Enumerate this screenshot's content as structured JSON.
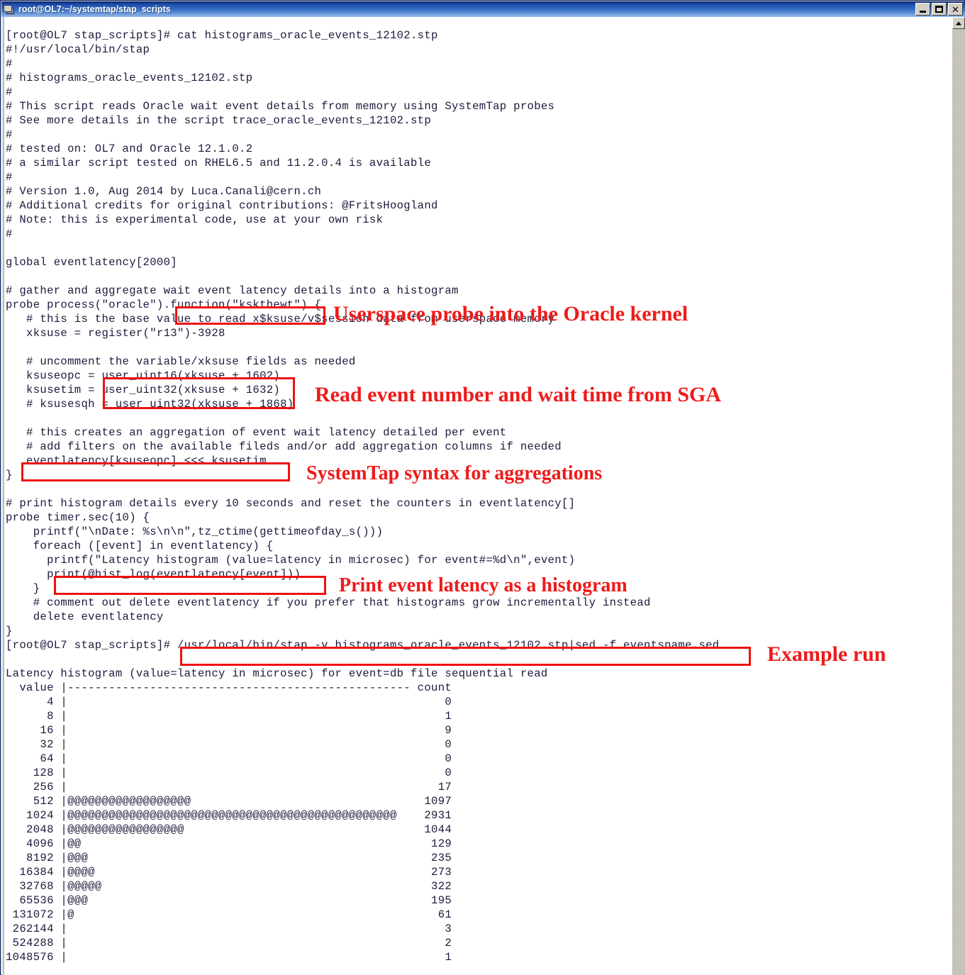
{
  "window": {
    "title": "root@OL7:~/systemtap/stap_scripts",
    "icon": "putty-terminal-icon",
    "buttons": {
      "minimize": "_",
      "maximize": "□",
      "close": "✕"
    }
  },
  "scrollbar": {
    "up_arrow": "scroll-up-arrow"
  },
  "terminal": {
    "text": "[root@OL7 stap_scripts]# cat histograms_oracle_events_12102.stp\n#!/usr/local/bin/stap\n#\n# histograms_oracle_events_12102.stp\n#\n# This script reads Oracle wait event details from memory using SystemTap probes\n# See more details in the script trace_oracle_events_12102.stp\n#\n# tested on: OL7 and Oracle 12.1.0.2\n# a similar script tested on RHEL6.5 and 11.2.0.4 is available\n#\n# Version 1.0, Aug 2014 by Luca.Canali@cern.ch\n# Additional credits for original contributions: @FritsHoogland\n# Note: this is experimental code, use at your own risk\n#\n\nglobal eventlatency[2000]\n\n# gather and aggregate wait event latency details into a histogram\nprobe process(\"oracle\").function(\"kskthewt\") {\n   # this is the base value to read x$ksuse/v$session data from userspace memory\n   xksuse = register(\"r13\")-3928\n\n   # uncomment the variable/xksuse fields as needed\n   ksuseopc = user_uint16(xksuse + 1602)\n   ksusetim = user_uint32(xksuse + 1632)\n   # ksusesqh = user_uint32(xksuse + 1868)\n\n   # this creates an aggregation of event wait latency detailed per event\n   # add filters on the available fileds and/or add aggregation columns if needed\n   eventlatency[ksuseopc] <<< ksusetim\n}\n\n# print histogram details every 10 seconds and reset the counters in eventlatency[]\nprobe timer.sec(10) {\n    printf(\"\\nDate: %s\\n\\n\",tz_ctime(gettimeofday_s()))\n    foreach ([event] in eventlatency) {\n      printf(\"Latency histogram (value=latency in microsec) for event#=%d\\n\",event)\n      print(@hist_log(eventlatency[event]))\n    }\n    # comment out delete eventlatency if you prefer that histograms grow incrementally instead\n    delete eventlatency\n}\n[root@OL7 stap_scripts]# /usr/local/bin/stap -v histograms_oracle_events_12102.stp|sed -f eventsname.sed\n\nLatency histogram (value=latency in microsec) for event=db file sequential read\n  value |-------------------------------------------------- count\n      4 |                                                       0\n      8 |                                                       1\n     16 |                                                       9\n     32 |                                                       0\n     64 |                                                       0\n    128 |                                                       0\n    256 |                                                      17\n    512 |@@@@@@@@@@@@@@@@@@                                  1097\n   1024 |@@@@@@@@@@@@@@@@@@@@@@@@@@@@@@@@@@@@@@@@@@@@@@@@    2931\n   2048 |@@@@@@@@@@@@@@@@@                                   1044\n   4096 |@@                                                   129\n   8192 |@@@                                                  235\n  16384 |@@@@                                                 273\n  32768 |@@@@@                                                322\n  65536 |@@@                                                  195\n 131072 |@                                                     61\n 262144 |                                                       3\n 524288 |                                                       2\n1048576 |                                                       1"
  },
  "annotations": [
    {
      "label": "Userspace probe into the Oracle kernel"
    },
    {
      "label": "Read event number and wait time from SGA"
    },
    {
      "label": "SystemTap syntax for aggregations"
    },
    {
      "label": "Print event latency as a histogram"
    },
    {
      "label": "Example run"
    }
  ],
  "highlight_boxes": [
    {
      "name": "box-function-kskthewt"
    },
    {
      "name": "box-user-uint-reads"
    },
    {
      "name": "box-eventlatency-aggregation"
    },
    {
      "name": "box-print-hist-log"
    },
    {
      "name": "box-example-run-command"
    }
  ],
  "colors": {
    "annotation_red": "#ef1a1a",
    "titlebar_blue": "#0a246a",
    "terminal_bg": "#ffffff",
    "terminal_fg": "#1a1a3c"
  },
  "chart_data": {
    "type": "bar",
    "title": "Latency histogram (value=latency in microsec) for event=db file sequential read",
    "xlabel": "count",
    "ylabel": "value",
    "categories": [
      4,
      8,
      16,
      32,
      64,
      128,
      256,
      512,
      1024,
      2048,
      4096,
      8192,
      16384,
      32768,
      65536,
      131072,
      262144,
      524288,
      1048576
    ],
    "values": [
      0,
      1,
      9,
      0,
      0,
      0,
      17,
      1097,
      2931,
      1044,
      129,
      235,
      273,
      322,
      195,
      61,
      3,
      2,
      1
    ],
    "bar_marks": [
      0,
      0,
      0,
      0,
      0,
      0,
      0,
      18,
      48,
      17,
      2,
      3,
      4,
      5,
      3,
      1,
      0,
      0,
      0
    ],
    "grid": false,
    "legend": "none"
  }
}
